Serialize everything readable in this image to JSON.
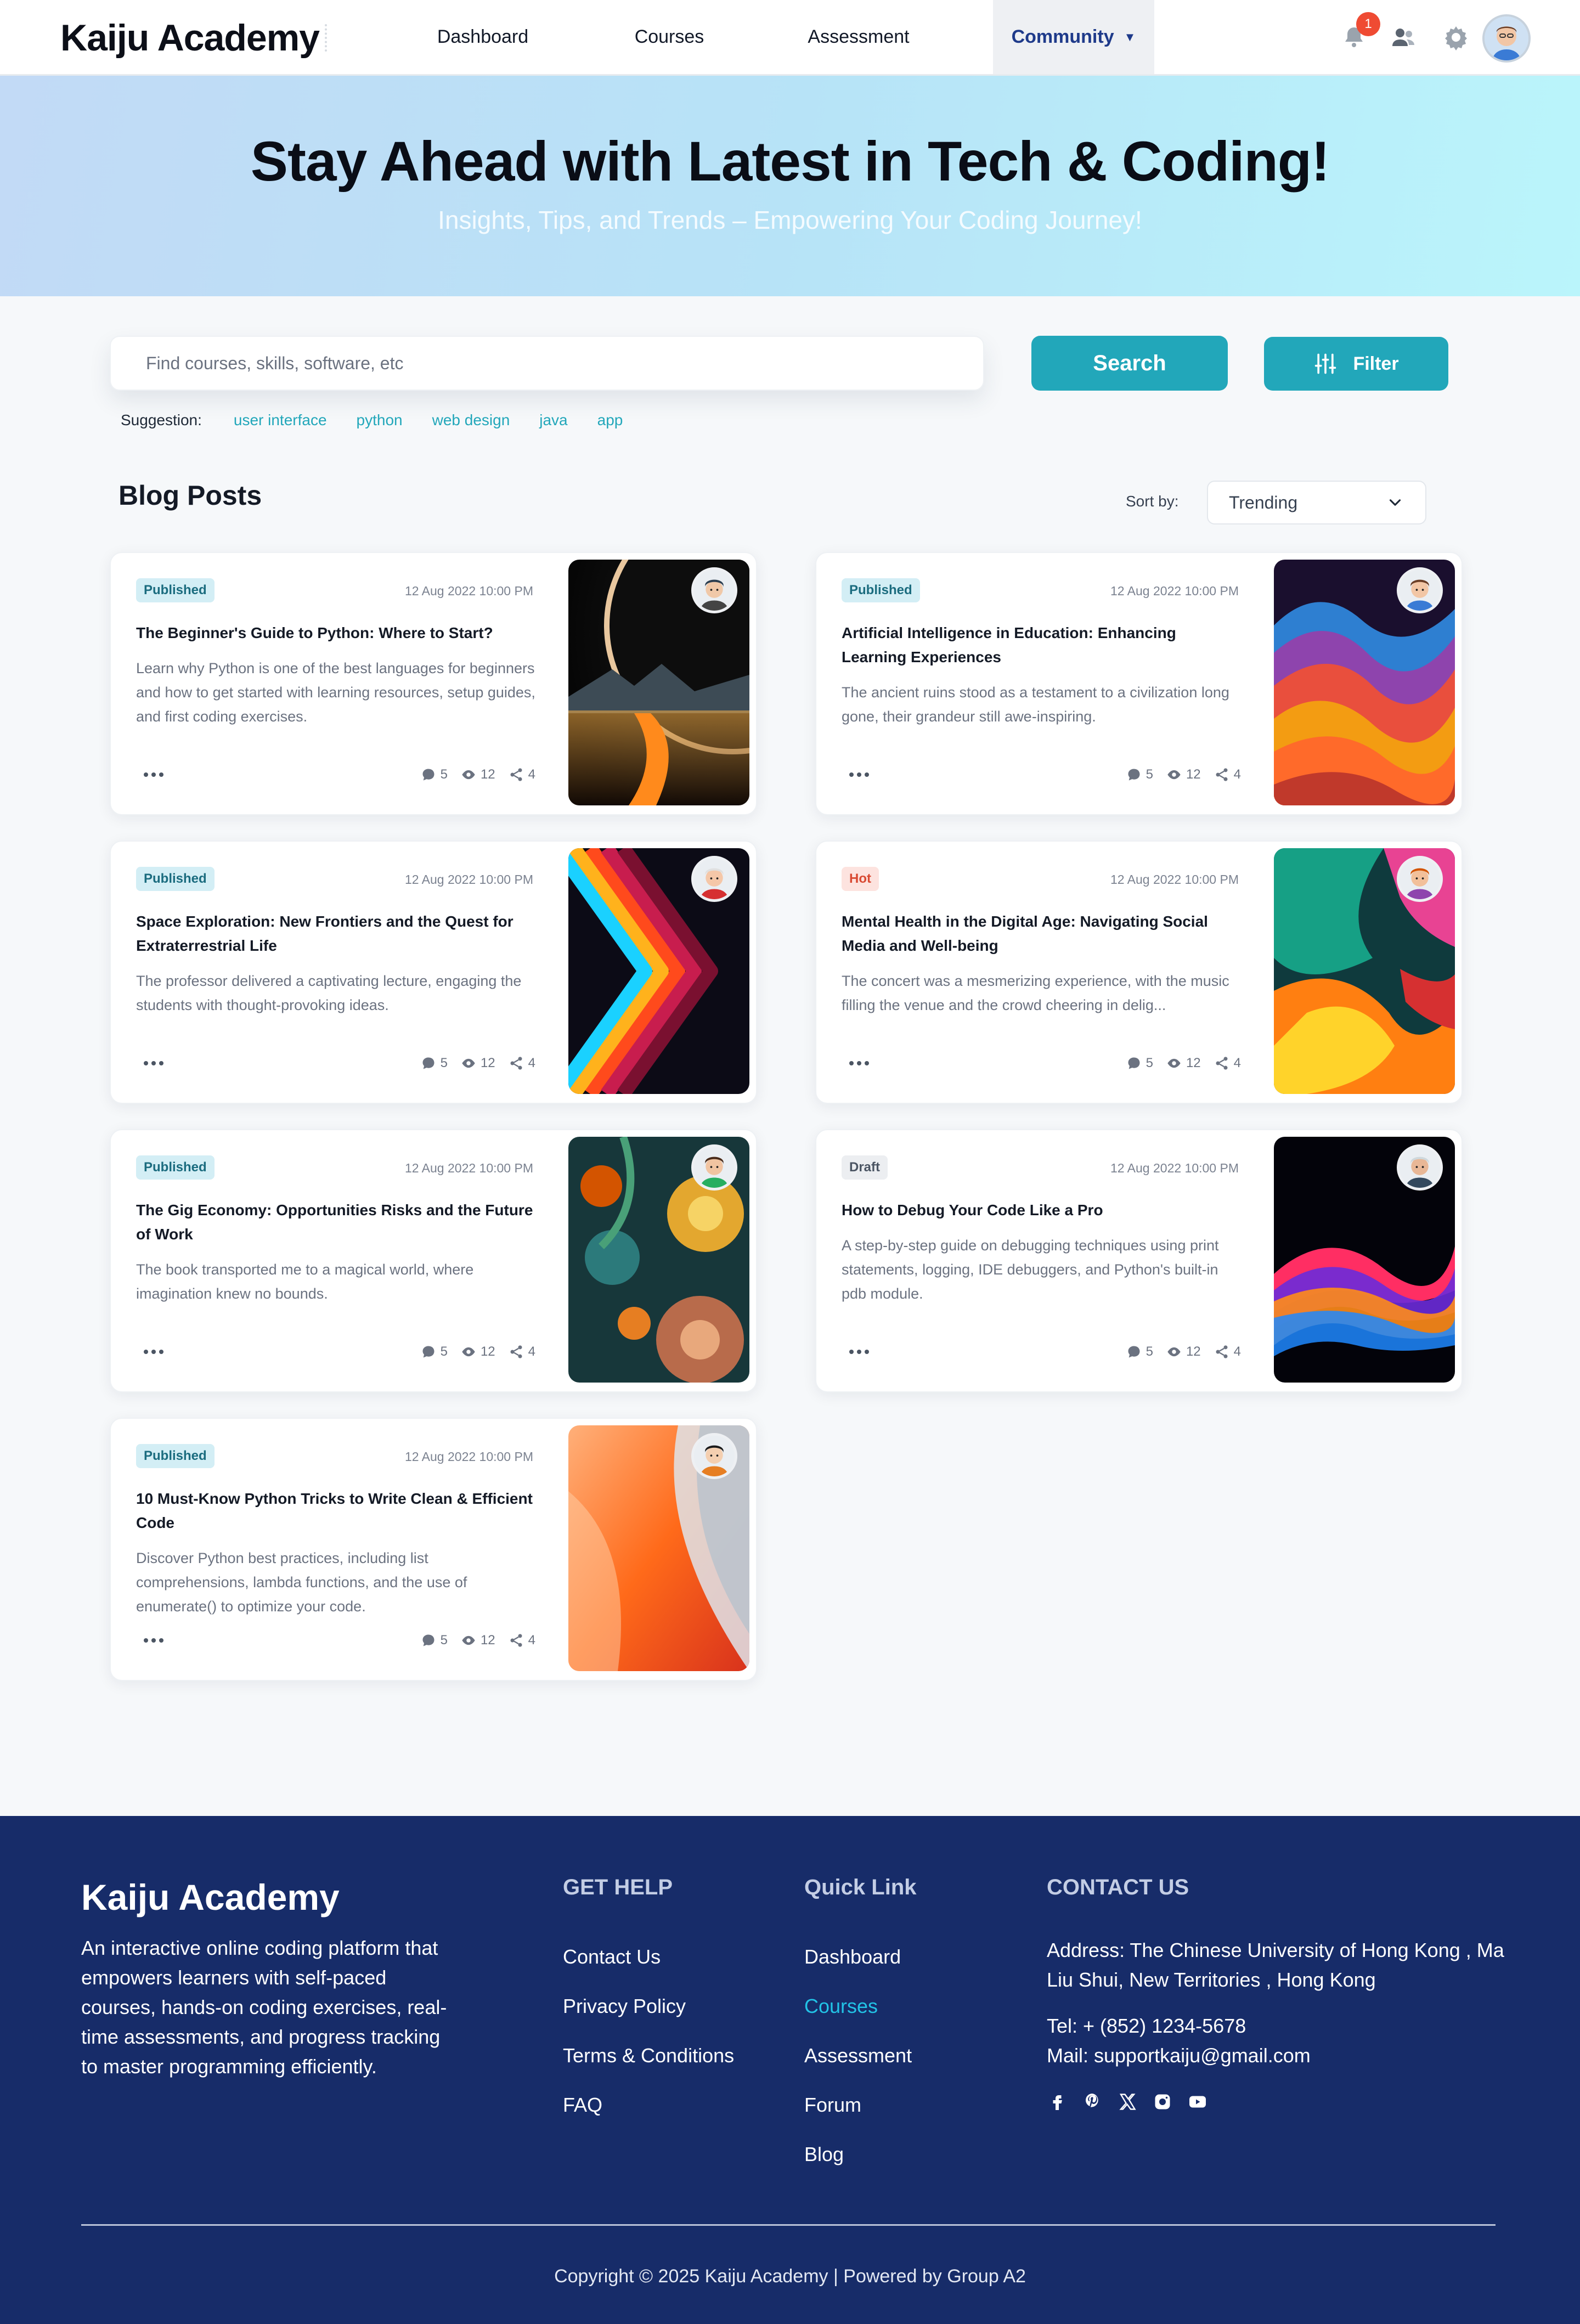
{
  "header": {
    "brand": "Kaiju Academy",
    "nav": [
      "Dashboard",
      "Courses",
      "Assessment",
      "Community"
    ],
    "active_nav": "Community",
    "notification_count": "1",
    "icons": [
      "bell-icon",
      "users-icon",
      "gear-icon",
      "avatar"
    ]
  },
  "hero": {
    "title": "Stay Ahead with Latest in Tech & Coding!",
    "subtitle": "Insights, Tips, and Trends – Empowering Your Coding Journey!"
  },
  "search": {
    "placeholder": "Find courses, skills, software, etc",
    "button_label": "Search",
    "filter_label": "Filter",
    "suggestion_label": "Suggestion:",
    "suggestions": [
      "user interface",
      "python",
      "web design",
      "java",
      "app"
    ]
  },
  "blog": {
    "heading": "Blog Posts",
    "sort_label": "Sort by:",
    "sort_value": "Trending",
    "posts": [
      {
        "status": "Published",
        "date": "12 Aug 2022 10:00 PM",
        "title": "The Beginner's Guide to Python: Where to Start?",
        "excerpt": "Learn why Python is one of the best languages for beginners and how to get started with learning resources, setup guides, and first coding exercises.",
        "comments": "5",
        "views": "12",
        "shares": "4"
      },
      {
        "status": "Published",
        "date": "12 Aug 2022 10:00 PM",
        "title": "Artificial Intelligence in Education: Enhancing Learning Experiences",
        "excerpt": "The ancient ruins stood as a testament to a civilization long gone, their grandeur still awe-inspiring.",
        "comments": "5",
        "views": "12",
        "shares": "4"
      },
      {
        "status": "Published",
        "date": "12 Aug 2022 10:00 PM",
        "title": "Space Exploration: New Frontiers and the Quest for Extraterrestrial Life",
        "excerpt": "The professor delivered a captivating lecture, engaging the students with thought-provoking ideas.",
        "comments": "5",
        "views": "12",
        "shares": "4"
      },
      {
        "status": "Hot",
        "date": "12 Aug 2022 10:00 PM",
        "title": "Mental Health in the Digital Age: Navigating Social Media and Well-being",
        "excerpt": "The concert was a mesmerizing experience, with the music filling the venue and the crowd cheering in delig...",
        "comments": "5",
        "views": "12",
        "shares": "4"
      },
      {
        "status": "Published",
        "date": "12 Aug 2022 10:00 PM",
        "title": "The Gig Economy: Opportunities Risks and the Future of Work",
        "excerpt": "The book transported me to a magical world, where imagination knew no bounds.",
        "comments": "5",
        "views": "12",
        "shares": "4"
      },
      {
        "status": "Draft",
        "date": "12 Aug 2022 10:00 PM",
        "title": "How to Debug Your Code Like a Pro",
        "excerpt": "A step-by-step guide on debugging techniques using print statements, logging, IDE debuggers, and Python's built-in pdb module.",
        "comments": "5",
        "views": "12",
        "shares": "4"
      },
      {
        "status": "Published",
        "date": "12 Aug 2022 10:00 PM",
        "title": "10 Must-Know Python Tricks to Write Clean & Efficient Code",
        "excerpt": "Discover Python best practices, including list comprehensions, lambda functions, and the use of enumerate() to optimize your code.",
        "comments": "5",
        "views": "12",
        "shares": "4"
      }
    ]
  },
  "footer": {
    "brand": "Kaiju Academy",
    "description": "An interactive online coding platform that empowers learners with self-paced courses, hands-on coding exercises, real-time assessments, and progress tracking to master programming efficiently.",
    "get_help_title": "GET HELP",
    "get_help_links": [
      "Contact Us",
      "Privacy Policy",
      "Terms & Conditions",
      "FAQ"
    ],
    "quick_link_title": "Quick Link",
    "quick_links": [
      "Dashboard",
      "Courses",
      "Assessment",
      "Forum",
      "Blog"
    ],
    "active_quick_link": "Courses",
    "contact_title": "CONTACT US",
    "address": "Address: The Chinese University of Hong Kong , Ma Liu Shui, New Territories , Hong Kong",
    "tel": "Tel: + (852) 1234-5678",
    "mail": "Mail: supportkaiju@gmail.com",
    "social_icons": [
      "facebook-icon",
      "pinterest-icon",
      "x-icon",
      "instagram-icon",
      "youtube-icon"
    ],
    "copyright": "Copyright © 2025 Kaiju Academy | Powered by Group A2"
  },
  "colors": {
    "accent": "#22a7ba",
    "footer_bg": "#172c69",
    "active_nav": "#1e3a8a",
    "hot": "#d94a33"
  }
}
